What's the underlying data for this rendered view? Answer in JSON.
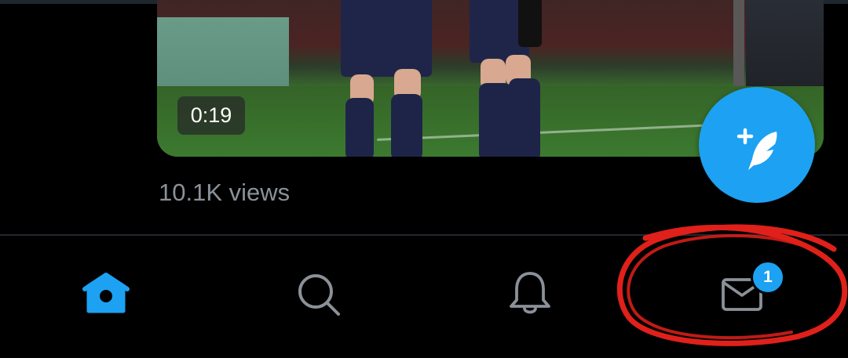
{
  "video": {
    "duration": "0:19",
    "views": "10.1K views"
  },
  "fab": {
    "icon": "compose-tweet-icon"
  },
  "bottom_nav": {
    "items": [
      {
        "name": "home",
        "icon": "home-icon",
        "active": true
      },
      {
        "name": "search",
        "icon": "search-icon",
        "active": false
      },
      {
        "name": "notifications",
        "icon": "bell-icon",
        "active": false
      },
      {
        "name": "messages",
        "icon": "mail-icon",
        "active": false,
        "badge": "1"
      }
    ]
  },
  "colors": {
    "accent": "#1da1f2",
    "background": "#000000",
    "icon_inactive": "#8b9198",
    "annotation": "#e0201a"
  }
}
